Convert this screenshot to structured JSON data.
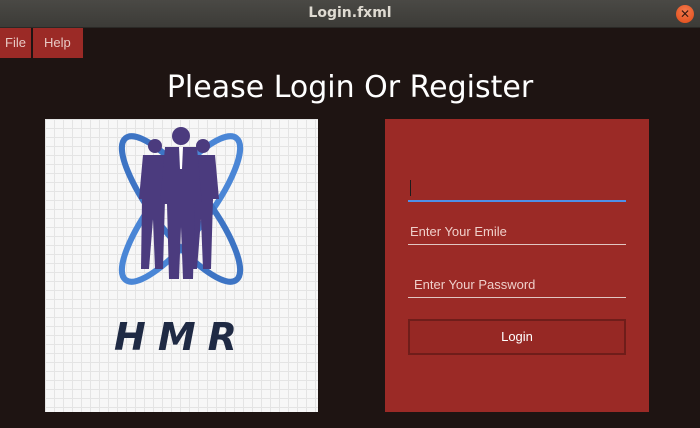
{
  "window": {
    "title": "Login.fxml"
  },
  "menu": {
    "file": "File",
    "help": "Help"
  },
  "heading": "Please Login Or Register",
  "logo": {
    "text": "HMR",
    "colors": {
      "ring": "#4a86d6",
      "figures": "#4b3b7e",
      "text": "#1f2a44"
    }
  },
  "form": {
    "name_value": "",
    "email_placeholder": "Enter Your Emile",
    "password_placeholder": "Enter Your Password",
    "login_label": "Login"
  },
  "colors": {
    "accent": "#9b2a26",
    "background": "#1e1412",
    "focus": "#4f8fe8"
  }
}
